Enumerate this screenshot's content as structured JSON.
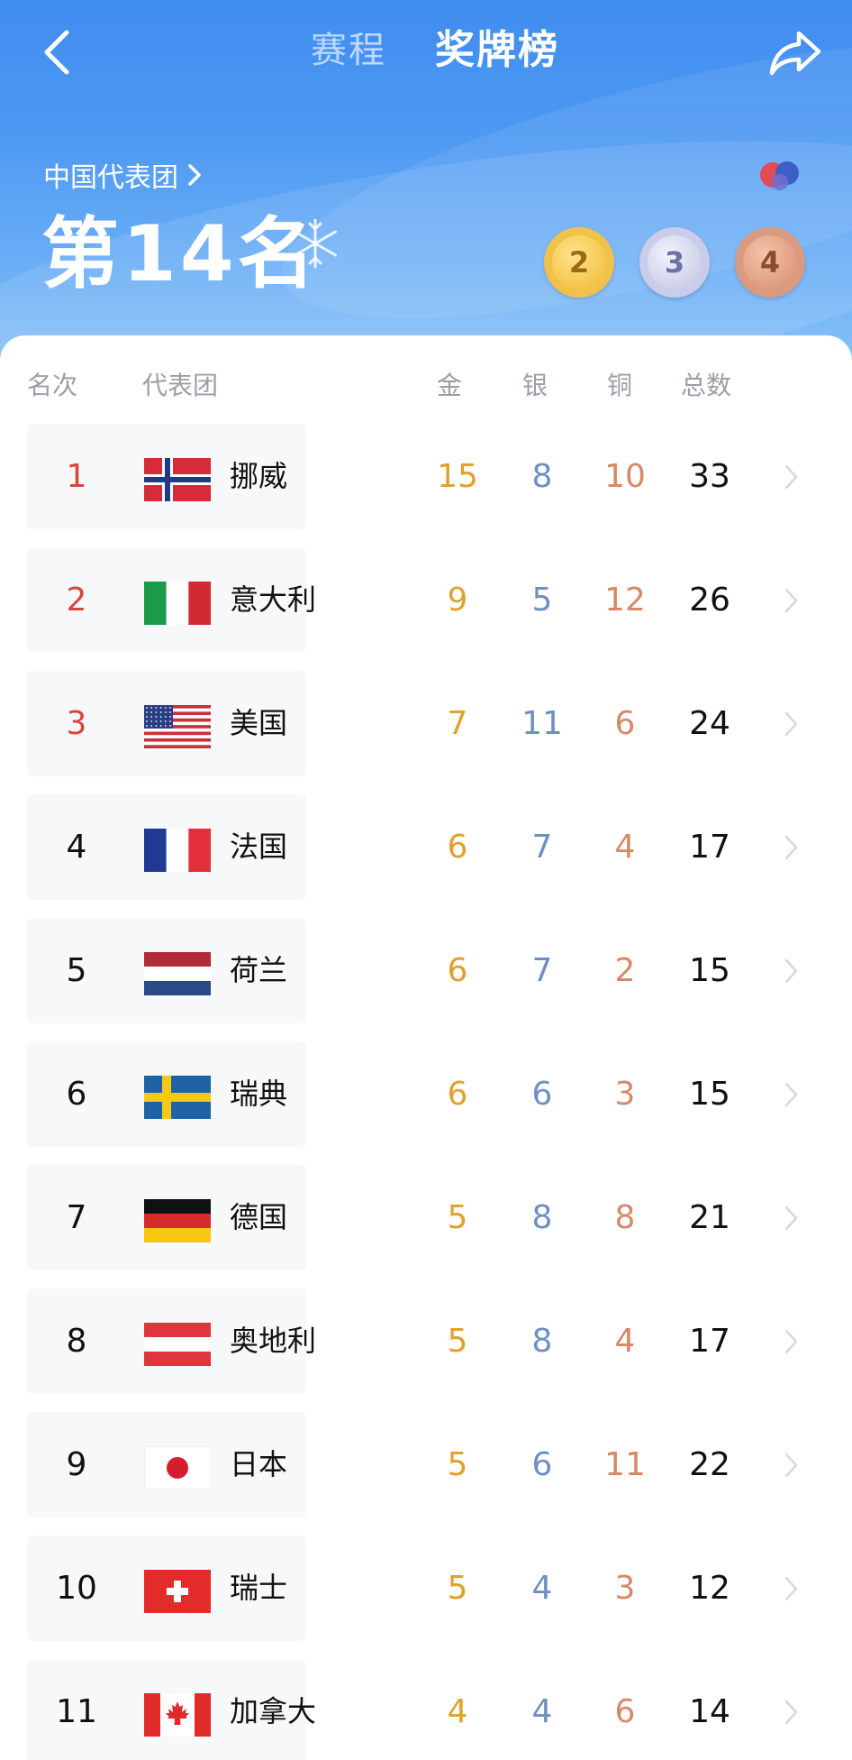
{
  "header": {
    "tabs": [
      {
        "label": "赛程",
        "active": false
      },
      {
        "label": "奖牌榜",
        "active": true
      }
    ]
  },
  "summary": {
    "delegation": "中国代表团",
    "rank_text": "第14名",
    "medals": {
      "gold": "2",
      "silver": "3",
      "bronze": "4"
    }
  },
  "table": {
    "headers": {
      "rank": "名次",
      "team": "代表团",
      "gold": "金",
      "silver": "银",
      "bronze": "铜",
      "total": "总数"
    },
    "rows": [
      {
        "rank": "1",
        "team": "挪威",
        "flag": "norway",
        "gold": "15",
        "silver": "8",
        "bronze": "10",
        "total": "33"
      },
      {
        "rank": "2",
        "team": "意大利",
        "flag": "italy",
        "gold": "9",
        "silver": "5",
        "bronze": "12",
        "total": "26"
      },
      {
        "rank": "3",
        "team": "美国",
        "flag": "usa",
        "gold": "7",
        "silver": "11",
        "bronze": "6",
        "total": "24"
      },
      {
        "rank": "4",
        "team": "法国",
        "flag": "france",
        "gold": "6",
        "silver": "7",
        "bronze": "4",
        "total": "17"
      },
      {
        "rank": "5",
        "team": "荷兰",
        "flag": "netherlands",
        "gold": "6",
        "silver": "7",
        "bronze": "2",
        "total": "15"
      },
      {
        "rank": "6",
        "team": "瑞典",
        "flag": "sweden",
        "gold": "6",
        "silver": "6",
        "bronze": "3",
        "total": "15"
      },
      {
        "rank": "7",
        "team": "德国",
        "flag": "germany",
        "gold": "5",
        "silver": "8",
        "bronze": "8",
        "total": "21"
      },
      {
        "rank": "8",
        "team": "奥地利",
        "flag": "austria",
        "gold": "5",
        "silver": "8",
        "bronze": "4",
        "total": "17"
      },
      {
        "rank": "9",
        "team": "日本",
        "flag": "japan",
        "gold": "5",
        "silver": "6",
        "bronze": "11",
        "total": "22"
      },
      {
        "rank": "10",
        "team": "瑞士",
        "flag": "switzerland",
        "gold": "5",
        "silver": "4",
        "bronze": "3",
        "total": "12"
      },
      {
        "rank": "11",
        "team": "加拿大",
        "flag": "canada",
        "gold": "4",
        "silver": "4",
        "bronze": "6",
        "total": "14"
      }
    ]
  },
  "colors": {
    "header_blue": "#3f8df0",
    "top_rank_red": "#d9443c",
    "gold": "#e0a12e",
    "silver": "#6f8fc4",
    "bronze": "#d68966"
  },
  "icons": {
    "back": "chevron-left-icon",
    "share": "share-arrow-icon",
    "delegation_chevron": "chevron-right-icon",
    "snowflake": "snowflake-icon",
    "row_chevron": "chevron-right-icon"
  }
}
